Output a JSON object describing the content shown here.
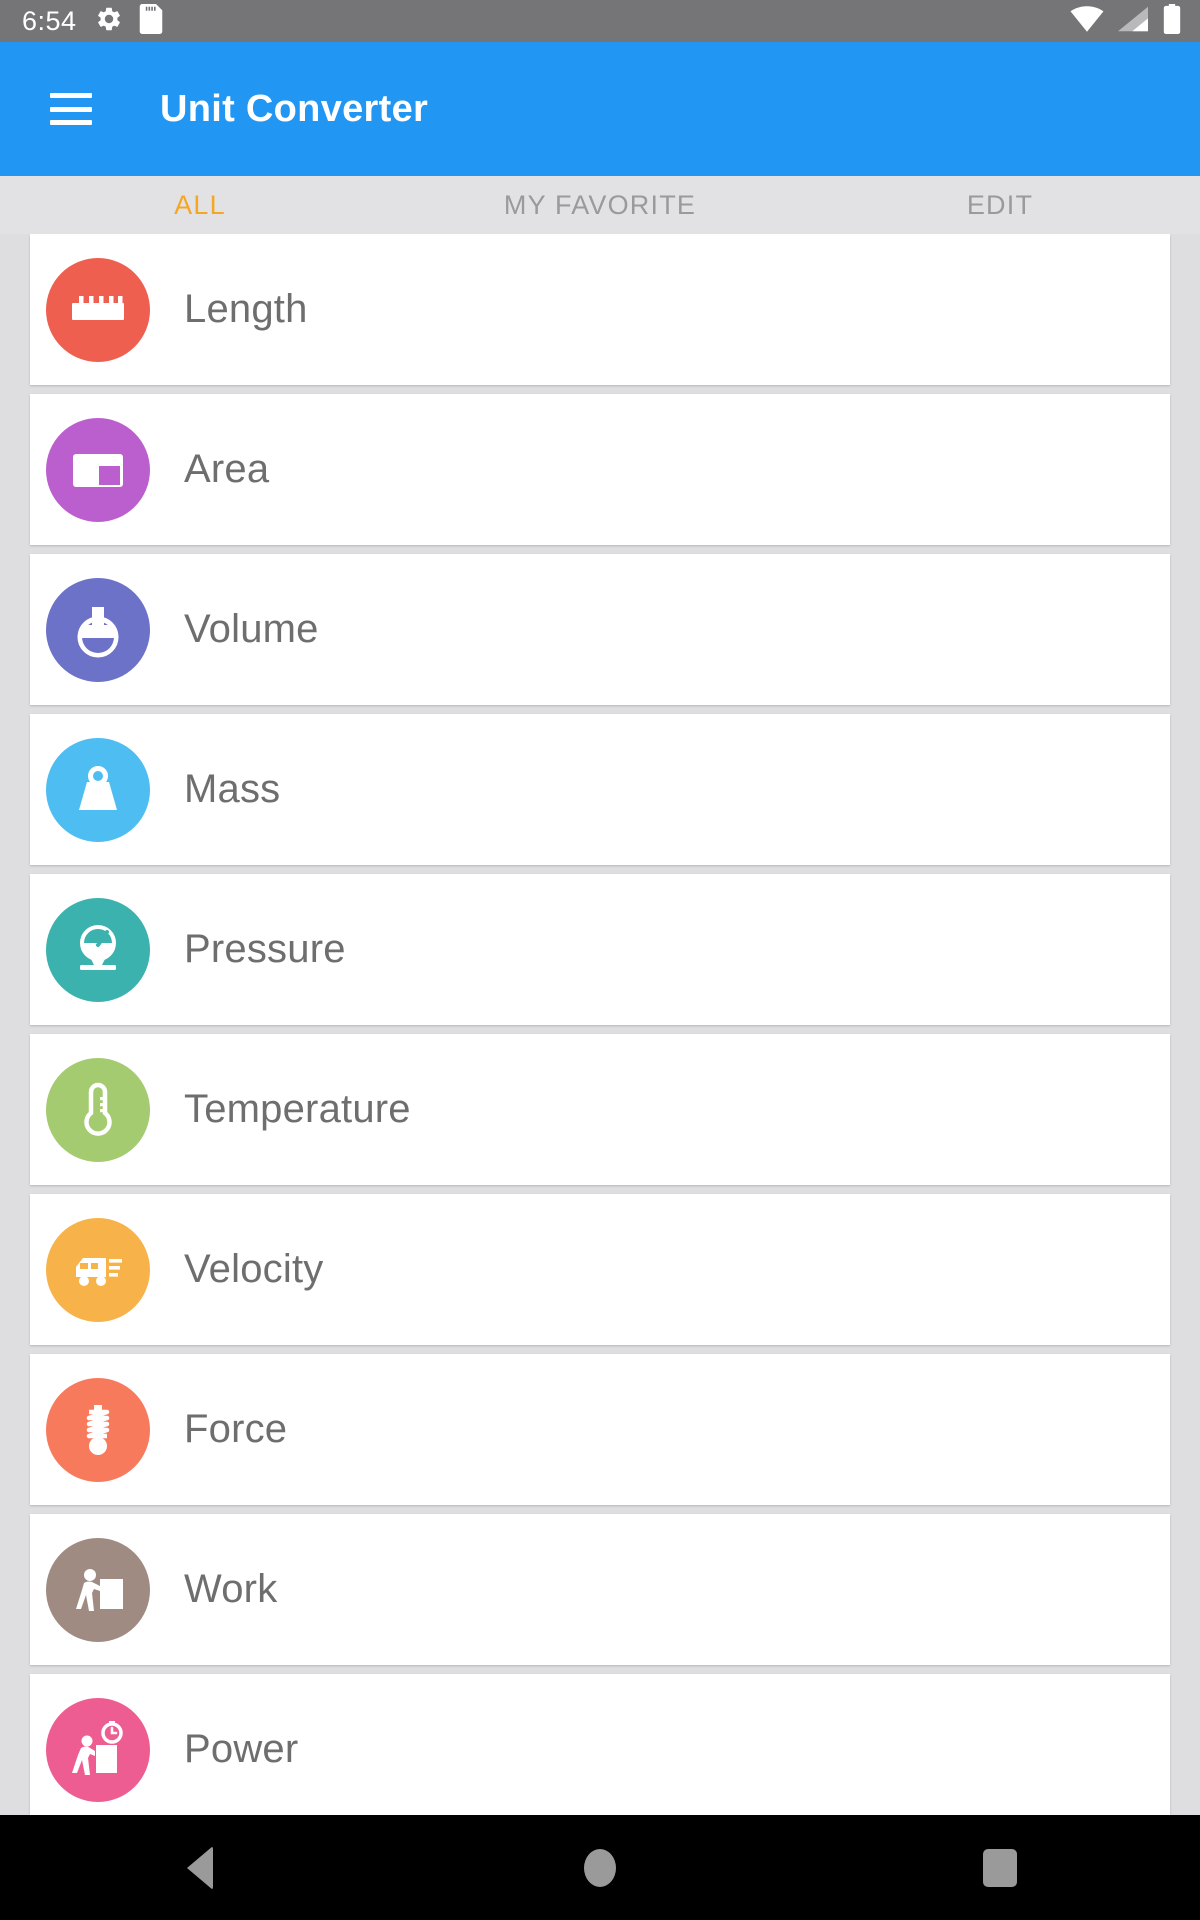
{
  "status_bar": {
    "time": "6:54",
    "left_icons": [
      "gear-icon",
      "sd-card-icon"
    ],
    "right_icons": [
      "wifi-icon",
      "cellular-signal-icon",
      "battery-icon"
    ],
    "background_color": "#757578"
  },
  "app_bar": {
    "menu_icon": "hamburger-menu-icon",
    "title": "Unit Converter",
    "background_color": "#2196f3"
  },
  "tabs": {
    "items": [
      {
        "label": "ALL",
        "active": true
      },
      {
        "label": "MY FAVORITE",
        "active": false
      },
      {
        "label": "EDIT",
        "active": false
      }
    ],
    "active_color": "#f5a623",
    "inactive_color": "#9a9a9e",
    "background_color": "#e2e2e5"
  },
  "list": {
    "items": [
      {
        "label": "Length",
        "icon": "ruler-icon",
        "color": "#ef5f50"
      },
      {
        "label": "Area",
        "icon": "area-rect-icon",
        "color": "#bc5fce"
      },
      {
        "label": "Volume",
        "icon": "flask-icon",
        "color": "#6d72c9"
      },
      {
        "label": "Mass",
        "icon": "weight-icon",
        "color": "#4ebdf2"
      },
      {
        "label": "Pressure",
        "icon": "gauge-icon",
        "color": "#3bb2ad"
      },
      {
        "label": "Temperature",
        "icon": "thermometer-icon",
        "color": "#a4cb6f"
      },
      {
        "label": "Velocity",
        "icon": "van-icon",
        "color": "#f7b24a"
      },
      {
        "label": "Force",
        "icon": "spring-icon",
        "color": "#f87a5c"
      },
      {
        "label": "Work",
        "icon": "person-push-box-icon",
        "color": "#a08b82"
      },
      {
        "label": "Power",
        "icon": "person-push-box-stopwatch-icon",
        "color": "#ee5d92"
      }
    ],
    "label_color": "#6e6e6e",
    "card_background": "#ffffff",
    "page_background": "#dedee1"
  },
  "nav_bar": {
    "buttons": [
      {
        "name": "back-button",
        "icon": "triangle-back-icon"
      },
      {
        "name": "home-button",
        "icon": "circle-home-icon"
      },
      {
        "name": "recents-button",
        "icon": "square-recents-icon"
      }
    ],
    "background_color": "#000000",
    "icon_color": "#9a9a9a"
  }
}
